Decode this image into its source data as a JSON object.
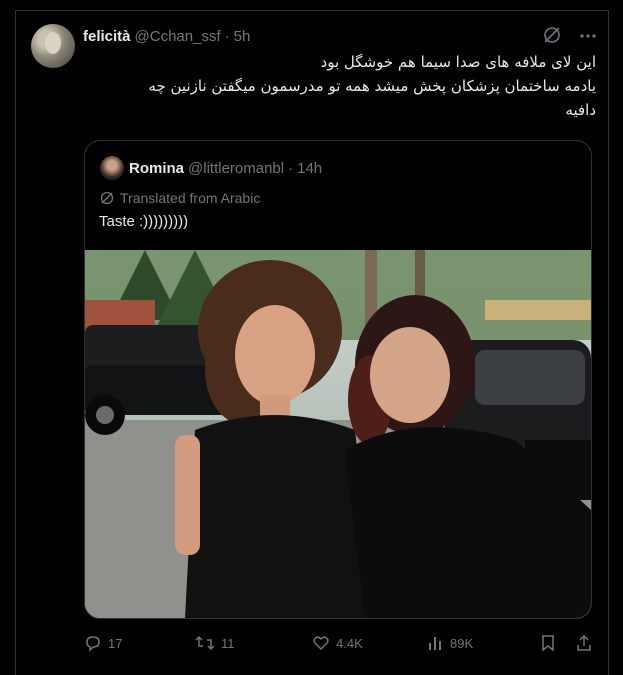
{
  "tweet": {
    "author_name": "felicità",
    "author_handle": "@Cchan_ssf",
    "separator": "·",
    "time": "5h",
    "text_lines": [
      "این لای ملافه های صدا سیما هم خوشگل بود",
      "یادمه ساختمان پزشکان پخش میشد همه تو مدرسمون میگفتن نازنین چه",
      "دافیه"
    ]
  },
  "quote": {
    "author_name": "Romina",
    "author_handle": "@littleromanbl",
    "separator": "·",
    "time": "14h",
    "translated_label": "Translated from Arabic",
    "text": "Taste :)))))))))"
  },
  "actions": {
    "replies": "17",
    "reposts": "11",
    "likes": "4.4K",
    "views": "89K"
  },
  "colors": {
    "background": "#000000",
    "text": "#e7e9ea",
    "muted": "#71767b",
    "border": "#2f3336"
  },
  "icons": [
    "grok-icon",
    "more-icon",
    "translate-icon",
    "reply-icon",
    "repost-icon",
    "like-icon",
    "views-icon",
    "bookmark-icon",
    "share-icon"
  ]
}
